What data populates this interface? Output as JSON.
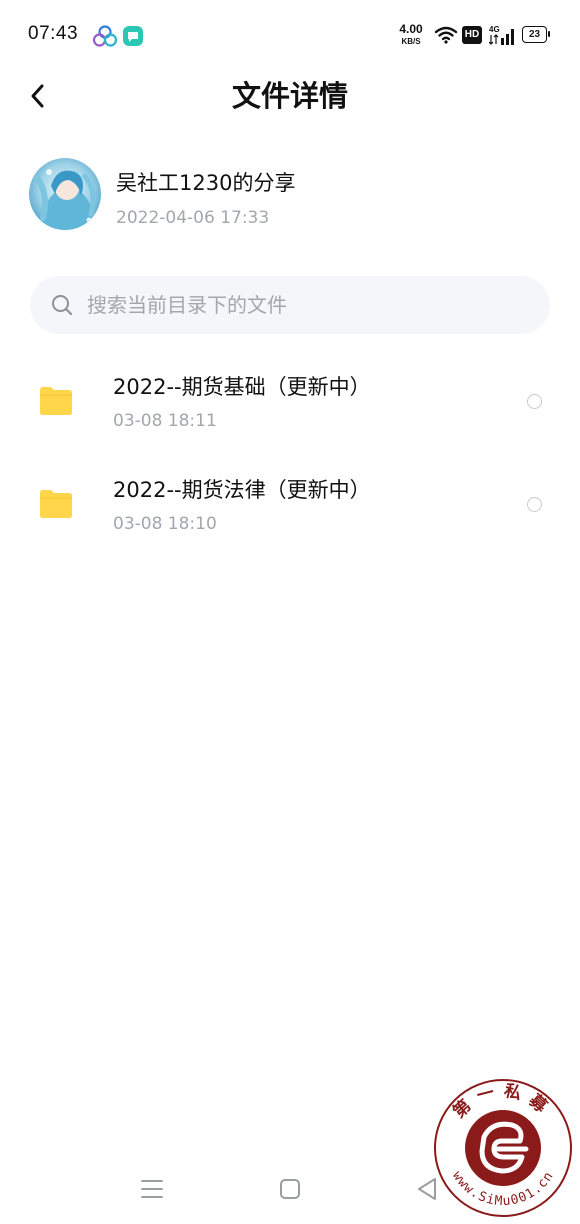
{
  "status_bar": {
    "time": "07:43",
    "net_speed_value": "4.00",
    "net_speed_unit": "KB/S",
    "hd_badge": "HD",
    "signal_label": "4G",
    "battery": "23",
    "icons": [
      "app-notification-icon",
      "chat-notification-icon",
      "wifi-icon",
      "signal-icon",
      "battery-icon"
    ]
  },
  "header": {
    "title": "文件详情",
    "back_icon": "chevron-left-icon"
  },
  "owner": {
    "name": "吴社工1230的分享",
    "date": "2022-04-06  17:33"
  },
  "search": {
    "placeholder": "搜索当前目录下的文件",
    "value": ""
  },
  "files": [
    {
      "name": "2022--期货基础（更新中）",
      "time": "03-08  18:11",
      "icon": "folder-icon"
    },
    {
      "name": "2022--期货法律（更新中）",
      "time": "03-08  18:10",
      "icon": "folder-icon"
    }
  ],
  "nav_bar": {
    "icons": [
      "menu-icon",
      "home-icon",
      "back-triangle-icon"
    ]
  },
  "watermark": {
    "top_text": "第一私募",
    "bottom_text": "www.SiMu001.cn"
  },
  "colors": {
    "folder": "#ffd54a",
    "secondary_text": "#a3a7ad",
    "search_bg": "#f4f6fa",
    "watermark": "#8b1a1a"
  }
}
